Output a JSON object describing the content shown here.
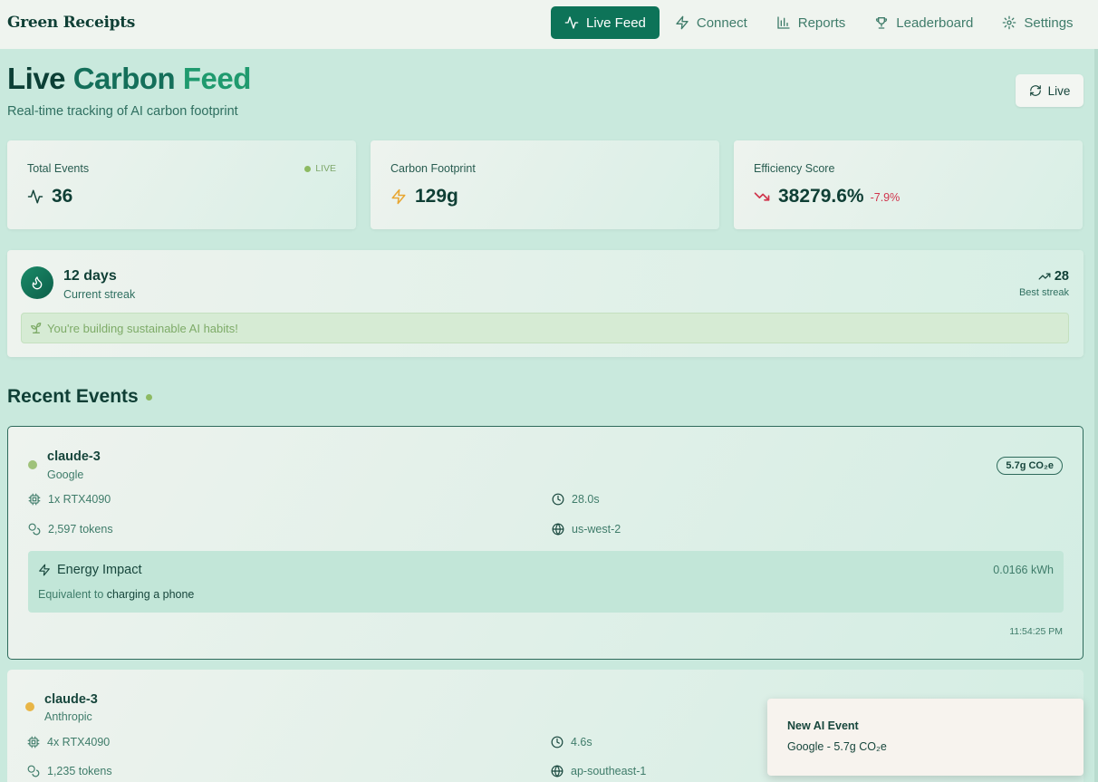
{
  "app": {
    "name": "Green Receipts"
  },
  "nav": {
    "items": [
      {
        "label": "Live Feed",
        "icon": "activity-icon"
      },
      {
        "label": "Connect",
        "icon": "bolt-icon"
      },
      {
        "label": "Reports",
        "icon": "bar-chart-icon"
      },
      {
        "label": "Leaderboard",
        "icon": "trophy-icon"
      },
      {
        "label": "Settings",
        "icon": "gear-icon"
      }
    ],
    "active_index": 0
  },
  "header": {
    "title_part1": "Live",
    "title_part2": "Carbon",
    "title_part3": "Feed",
    "subtitle": "Real-time tracking of AI carbon footprint",
    "live_button_label": "Live"
  },
  "stats": {
    "total_events": {
      "label": "Total Events",
      "value": "36",
      "badge": "LIVE",
      "icon": "activity-icon"
    },
    "carbon_footprint": {
      "label": "Carbon Footprint",
      "value": "129g",
      "icon": "bolt-icon"
    },
    "efficiency_score": {
      "label": "Efficiency Score",
      "value": "38279.6%",
      "delta": "-7.9%",
      "icon": "trending-down-icon"
    }
  },
  "streak": {
    "days": "12 days",
    "label": "Current streak",
    "best_value": "28",
    "best_label": "Best streak",
    "message": "You're building sustainable AI habits!"
  },
  "recent_events": {
    "title": "Recent Events",
    "events": [
      {
        "model": "claude-3",
        "provider": "Google",
        "co2": "5.7g CO₂e",
        "gpu": "1x RTX4090",
        "duration": "28.0s",
        "tokens": "2,597 tokens",
        "region": "us-west-2",
        "energy_title": "Energy Impact",
        "energy_kwh": "0.0166 kWh",
        "equivalent_prefix": "Equivalent to",
        "equivalent": "charging a phone",
        "time": "11:54:25 PM",
        "status_color": "#9fc27a"
      },
      {
        "model": "claude-3",
        "provider": "Anthropic",
        "gpu": "4x RTX4090",
        "duration": "4.6s",
        "tokens": "1,235 tokens",
        "region": "ap-southeast-1",
        "status_color": "#e8b546"
      }
    ]
  },
  "toast": {
    "title": "New AI Event",
    "message": "Google - 5.7g CO₂e"
  },
  "colors": {
    "accent": "#0d7358",
    "background": "#c9e9dd",
    "negative": "#d0344c",
    "warning": "#e8a631"
  }
}
